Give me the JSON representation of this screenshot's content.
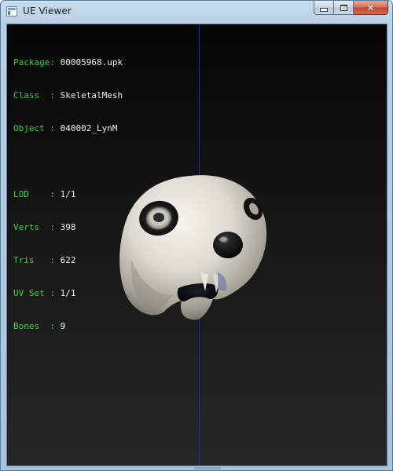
{
  "window": {
    "title": "UE Viewer",
    "icon": "app-window-icon",
    "caption_buttons": {
      "minimize": "minimize-icon",
      "maximize": "maximize-icon",
      "close": "close-icon"
    }
  },
  "info": {
    "package": {
      "label": "Package:",
      "value": "00005968.upk"
    },
    "class": {
      "label": "Class  :",
      "value": "SkeletalMesh"
    },
    "object": {
      "label": "Object :",
      "value": "040002_LynM"
    },
    "lod": {
      "label": "LOD    :",
      "value": "1/1"
    },
    "verts": {
      "label": "Verts  :",
      "value": "398"
    },
    "tris": {
      "label": "Tris   :",
      "value": "622"
    },
    "uvset": {
      "label": "UV Set :",
      "value": "1/1"
    },
    "bones": {
      "label": "Bones  :",
      "value": "9"
    }
  },
  "colors": {
    "label": "#3ad23a",
    "value": "#f0f0f0",
    "axis": "#2323c8",
    "viewport_top": "#050505",
    "viewport_bottom": "#262626"
  }
}
